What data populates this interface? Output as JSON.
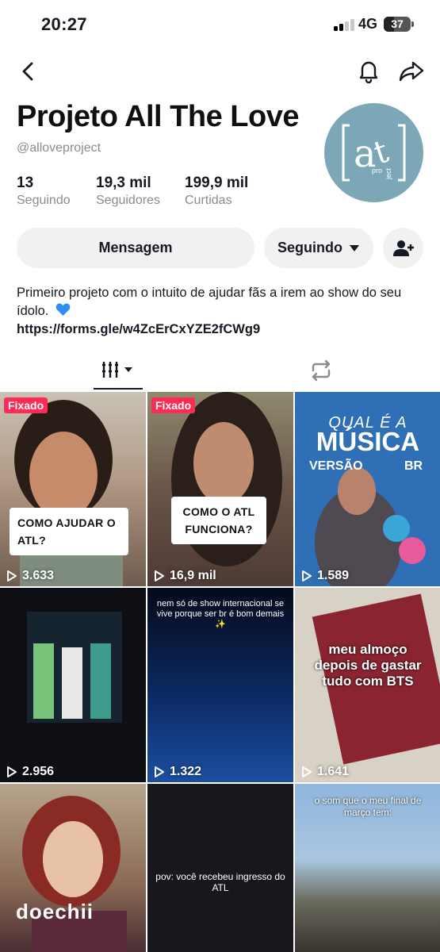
{
  "status_bar": {
    "time": "20:27",
    "network": "4G",
    "battery": "37",
    "battery_level_percent": 37
  },
  "profile": {
    "name": "Projeto All The Love",
    "handle": "@alloveproject",
    "stats": [
      {
        "value": "13",
        "label": "Seguindo"
      },
      {
        "value": "19,3 mil",
        "label": "Seguidores"
      },
      {
        "value": "199,9 mil",
        "label": "Curtidas"
      }
    ],
    "avatar": {
      "main": "a",
      "t": "t",
      "sub1": "pro",
      "sub2": "ject"
    }
  },
  "actions": {
    "message": "Mensagem",
    "following": "Seguindo"
  },
  "bio": {
    "text": "Primeiro projeto com o intuito de ajudar fãs a irem ao show do seu ídolo.",
    "link": "https://forms.gle/w4ZcErCxYZE2fCWg9"
  },
  "videos": [
    {
      "views": "3.633",
      "pinned": "Fixado",
      "caption": "COMO AJUDAR O ATL?"
    },
    {
      "views": "16,9 mil",
      "pinned": "Fixado",
      "caption": "COMO O ATL FUNCIONA?"
    },
    {
      "views": "1.589",
      "line1": "QUAL É A",
      "line2": "MÚSICA",
      "line3": "VERSÃO",
      "line4": "BR"
    },
    {
      "views": "2.956"
    },
    {
      "views": "1.322",
      "overlay": "nem só de show internacional se vive porque ser br é bom demais ✨"
    },
    {
      "views": "1.641",
      "overlay": "meu almoço depois de gastar tudo com BTS"
    },
    {
      "views": "",
      "overlay": "doechii"
    },
    {
      "views": "",
      "overlay": "pov: você recebeu ingresso do ATL"
    },
    {
      "views": "",
      "overlay": "o som que o meu final de março tem:"
    }
  ],
  "colors": {
    "pinned": "#fe2c55",
    "button_bg": "#f1f1f2",
    "avatar_bg": "#7ba7b6",
    "text": "#161823",
    "secondary": "#8a8b91"
  }
}
